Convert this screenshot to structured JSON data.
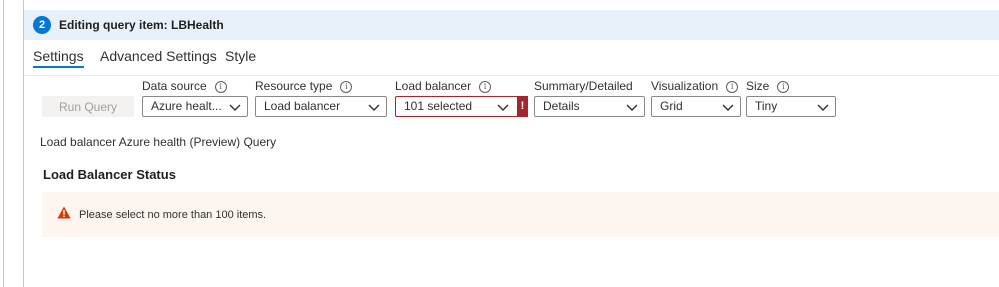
{
  "header": {
    "step_number": "2",
    "title": "Editing query item: LBHealth"
  },
  "tabs": [
    {
      "label": "Settings",
      "active": true
    },
    {
      "label": "Advanced Settings",
      "active": false
    },
    {
      "label": "Style",
      "active": false
    }
  ],
  "toolbar": {
    "run_query_label": "Run Query",
    "fields": [
      {
        "label": "Data source",
        "value": "Azure healt..."
      },
      {
        "label": "Resource type",
        "value": "Load balancer"
      },
      {
        "label": "Load balancer",
        "value": "101 selected",
        "error": true,
        "error_glyph": "!"
      },
      {
        "label": "Summary/Detailed",
        "value": "Details"
      },
      {
        "label": "Visualization",
        "value": "Grid"
      },
      {
        "label": "Size",
        "value": "Tiny"
      }
    ],
    "info_glyph": "i"
  },
  "content": {
    "query_description": "Load balancer Azure health (Preview) Query",
    "section_title": "Load Balancer Status",
    "warning_text": "Please select no more than 100 items."
  },
  "colors": {
    "accent": "#0078d4",
    "header_bg": "#e8f1fa",
    "error": "#a4262c",
    "warning_bg": "#fdf6f0",
    "warning_icon": "#d83b01"
  },
  "icons": [
    "info-icon",
    "chevron-down-icon",
    "error-icon",
    "warning-icon"
  ]
}
